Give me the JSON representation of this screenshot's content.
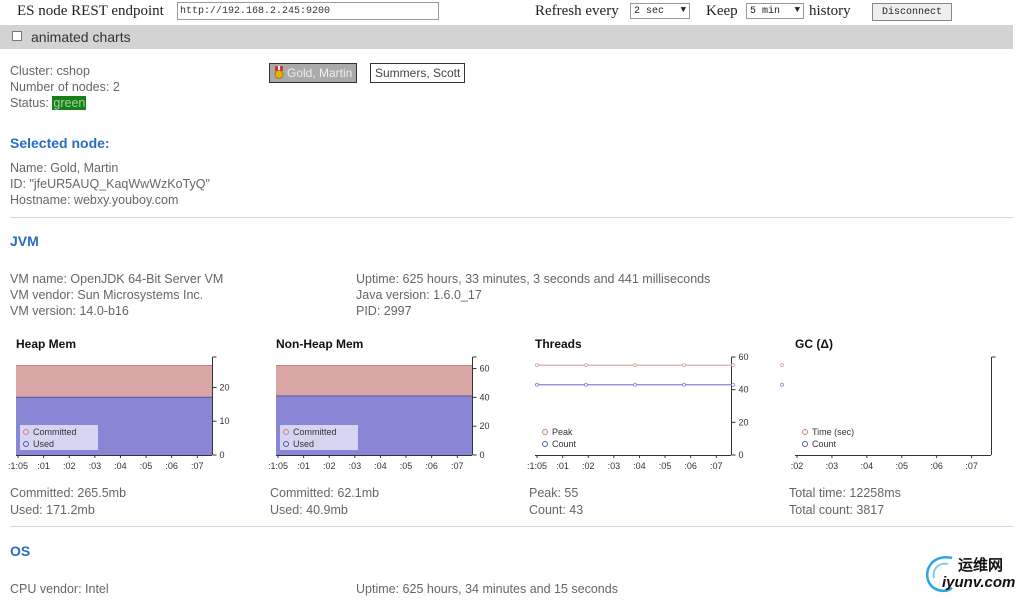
{
  "toolbar": {
    "endpoint_label": "ES node REST endpoint",
    "endpoint_value": "http://192.168.2.245:9200",
    "refresh_label": "Refresh every",
    "refresh_value": "2 sec",
    "keep_label": "Keep",
    "keep_value": "5 min",
    "history_label": "history",
    "disconnect_label": "Disconnect"
  },
  "options": {
    "animated_charts_label": "animated charts",
    "animated_charts_checked": false
  },
  "cluster": {
    "name_line": "Cluster: cshop",
    "nodes_line": "Number of nodes: 2",
    "status_label": "Status: ",
    "status_value": "green",
    "status_color": "#177f17"
  },
  "nodes": [
    {
      "label": "Gold, Martin",
      "selected": true
    },
    {
      "label": "Summers, Scott",
      "selected": false
    }
  ],
  "selected_node": {
    "heading": "Selected node:",
    "name_line": "Name: Gold, Martin",
    "id_line": "ID: \"jfeUR5AUQ_KaqWwWzKoTyQ\"",
    "hostname_line": "Hostname: webxy.youboy.com"
  },
  "jvm": {
    "heading": "JVM",
    "vm_name": "VM name: OpenJDK 64-Bit Server VM",
    "vm_vendor": "VM vendor: Sun Microsystems Inc.",
    "vm_version": "VM version: 14.0-b16",
    "uptime": "Uptime: 625 hours, 33 minutes, 3 seconds and 441 milliseconds",
    "java_version": "Java version: 1.6.0_17",
    "pid": "PID: 2997"
  },
  "colors": {
    "committed": "#d9a6a6",
    "used": "#8a86d6",
    "peak_line": "#d9a0a0",
    "count_line": "#8080d8",
    "heading": "#2a6bc6"
  },
  "chart_data": [
    {
      "type": "area",
      "title": "Heap Mem",
      "x": [
        ":1:05",
        ":01",
        ":02",
        ":03",
        ":04",
        ":05",
        ":06",
        ":07"
      ],
      "series": [
        {
          "name": "Committed",
          "values": [
            265.5,
            265.5,
            265.5,
            265.5,
            265.5,
            265.5,
            265.5,
            265.5
          ]
        },
        {
          "name": "Used",
          "values": [
            171.2,
            171.2,
            171.2,
            171.2,
            171.2,
            171.2,
            171.2,
            171.2
          ]
        }
      ],
      "yticks": [
        0,
        10,
        20
      ],
      "ylim": [
        0,
        29
      ],
      "legend": "bottom-left",
      "committed_level": 26.5,
      "used_level": 17.1
    },
    {
      "type": "area",
      "title": "Non-Heap Mem",
      "x": [
        ":1:05",
        ":01",
        ":02",
        ":03",
        ":04",
        ":05",
        ":06",
        ":07"
      ],
      "series": [
        {
          "name": "Committed",
          "values": [
            62.1,
            62.1,
            62.1,
            62.1,
            62.1,
            62.1,
            62.1,
            62.1
          ]
        },
        {
          "name": "Used",
          "values": [
            40.9,
            40.9,
            40.9,
            40.9,
            40.9,
            40.9,
            40.9,
            40.9
          ]
        }
      ],
      "yticks": [
        0,
        20,
        40,
        60
      ],
      "ylim": [
        0,
        68
      ],
      "legend": "bottom-left",
      "committed_level": 62.1,
      "used_level": 40.9
    },
    {
      "type": "line",
      "title": "Threads",
      "x": [
        ":1:05",
        ":01",
        ":02",
        ":03",
        ":04",
        ":05",
        ":06",
        ":07"
      ],
      "series": [
        {
          "name": "Peak",
          "values": [
            55,
            55,
            55,
            55,
            55,
            55,
            55,
            55
          ]
        },
        {
          "name": "Count",
          "values": [
            43,
            43,
            43,
            43,
            43,
            43,
            43,
            43
          ]
        }
      ],
      "yticks": [
        0,
        20,
        40,
        60
      ],
      "ylim": [
        0,
        60
      ],
      "legend": "bottom-left"
    },
    {
      "type": "line",
      "title": "GC (Δ)",
      "x": [
        ":02",
        ":03",
        ":04",
        ":05",
        ":06",
        ":07"
      ],
      "series": [
        {
          "name": "Time (sec)",
          "values": [
            0,
            0,
            0,
            0,
            0,
            0
          ]
        },
        {
          "name": "Count",
          "values": [
            0,
            0,
            0,
            0,
            0,
            0
          ]
        }
      ],
      "yticks": [],
      "ylim": [
        0,
        1
      ],
      "legend": "bottom-left"
    }
  ],
  "stats": {
    "heap_committed": "Committed: 265.5mb",
    "heap_used": "Used: 171.2mb",
    "nonheap_committed": "Committed: 62.1mb",
    "nonheap_used": "Used: 40.9mb",
    "threads_peak": "Peak: 55",
    "threads_count": "Count: 43",
    "gc_total_time": "Total time: 12258ms",
    "gc_total_count": "Total count: 3817"
  },
  "os": {
    "heading": "OS",
    "cpu_vendor": "CPU vendor: Intel",
    "uptime": "Uptime: 625 hours, 34 minutes and 15 seconds"
  },
  "watermark": {
    "line1": "运维网",
    "line2": "iyunv.com"
  }
}
